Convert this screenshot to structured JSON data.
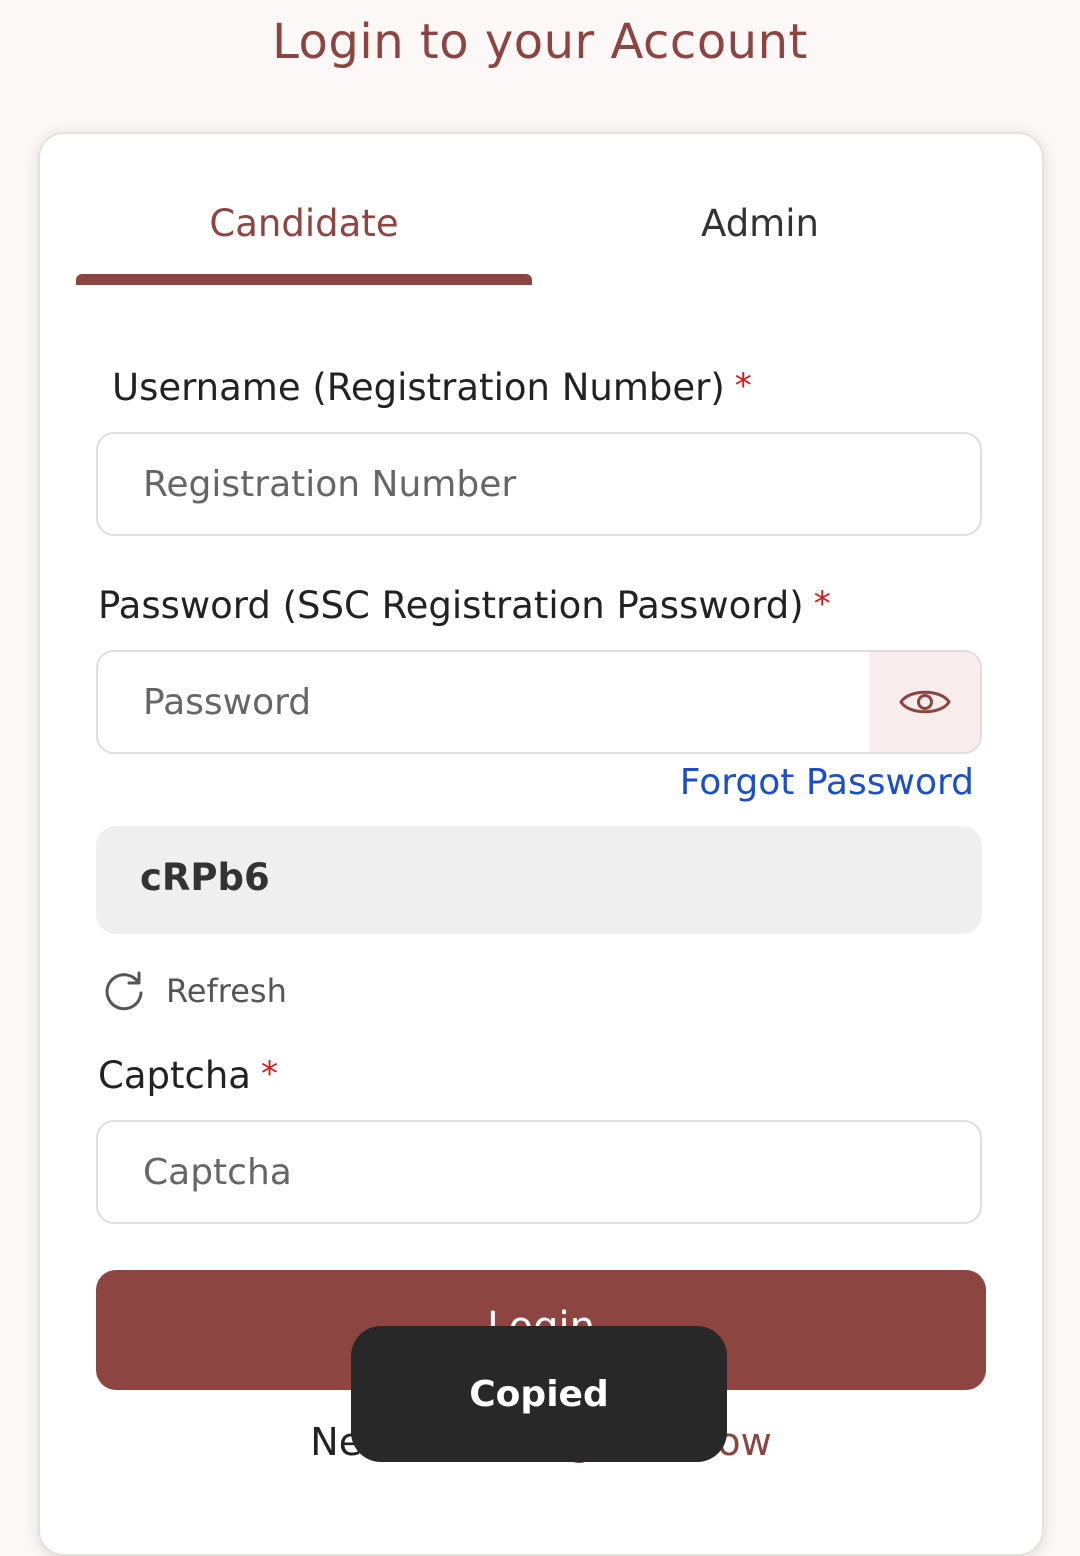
{
  "page_title": "Login to your Account",
  "tabs": [
    {
      "label": "Candidate",
      "active": true
    },
    {
      "label": "Admin",
      "active": false
    }
  ],
  "form": {
    "username": {
      "label": "Username (Registration Number)",
      "required_mark": "*",
      "placeholder": "Registration Number",
      "value": ""
    },
    "password": {
      "label": "Password (SSC Registration Password)",
      "required_mark": "*",
      "placeholder": "Password",
      "value": "",
      "toggle_icon": "eye-icon"
    },
    "forgot_password": "Forgot Password",
    "captcha_image_text": "cRPb6",
    "refresh_label": "Refresh",
    "refresh_icon": "refresh-icon",
    "captcha": {
      "label": "Captcha",
      "required_mark": "*",
      "placeholder": "Captcha",
      "value": ""
    },
    "login_label": "Login"
  },
  "register": {
    "prefix": "New user? ",
    "link": "Register Now"
  },
  "toast": {
    "text": "Copied"
  },
  "colors": {
    "brand": "#8d4541",
    "link": "#1a4fc9",
    "required": "#d31b1b"
  }
}
